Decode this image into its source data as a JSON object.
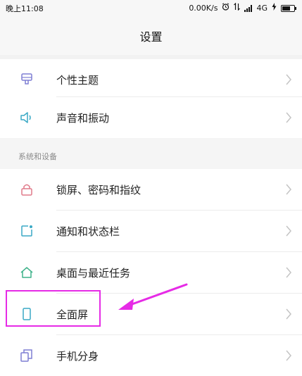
{
  "status_bar": {
    "time": "晚上11:08",
    "network_speed": "0.00K/s",
    "network_type": "4G",
    "icons": [
      "alarm-icon",
      "data-transfer-icon",
      "signal-icon",
      "battery-icon",
      "charging-icon"
    ]
  },
  "header": {
    "title": "设置"
  },
  "sections": [
    {
      "title": "",
      "items": [
        {
          "label": "个性主题",
          "icon": "theme-icon"
        },
        {
          "label": "声音和振动",
          "icon": "speaker-icon"
        }
      ]
    },
    {
      "title": "系统和设备",
      "items": [
        {
          "label": "锁屏、密码和指纹",
          "icon": "lock-icon"
        },
        {
          "label": "通知和状态栏",
          "icon": "notification-icon"
        },
        {
          "label": "桌面与最近任务",
          "icon": "home-icon"
        },
        {
          "label": "全面屏",
          "icon": "phone-screen-icon"
        },
        {
          "label": "手机分身",
          "icon": "clone-icon"
        }
      ]
    }
  ],
  "annotation": {
    "highlighted_item": "全面屏",
    "color": "#e62be6"
  },
  "colors": {
    "icon_tint": "#3aa9c5",
    "theme_icon": "#7f7fd4",
    "lock_icon": "#e07a8a",
    "home_icon": "#3fb28a",
    "chevron": "#c4c4c4",
    "annotation": "#e62be6"
  }
}
